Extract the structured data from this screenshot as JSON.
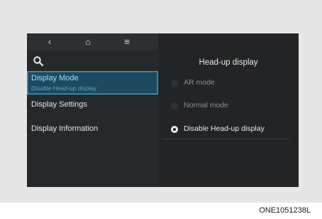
{
  "nav": {
    "back_glyph": "‹",
    "home_glyph": "⌂",
    "menu_glyph": "≡"
  },
  "sidebar": {
    "items": [
      {
        "label": "Display Mode",
        "sublabel": "Disable Head-up display",
        "selected": true
      },
      {
        "label": "Display Settings"
      },
      {
        "label": "Display Information"
      }
    ]
  },
  "panel": {
    "title": "Head-up display",
    "options": [
      {
        "label": "AR mode",
        "selected": false
      },
      {
        "label": "Normal mode",
        "selected": false
      },
      {
        "label": "Disable Head-up display",
        "selected": true
      }
    ]
  },
  "caption": "ONE1051238L",
  "icons": {
    "search": "search-icon",
    "back": "back-icon",
    "home": "home-icon",
    "menu": "menu-icon"
  },
  "colors": {
    "selected_bg": "#1d4a60",
    "selected_border": "#3c9bbb",
    "selected_text": "#9fe0f2"
  }
}
